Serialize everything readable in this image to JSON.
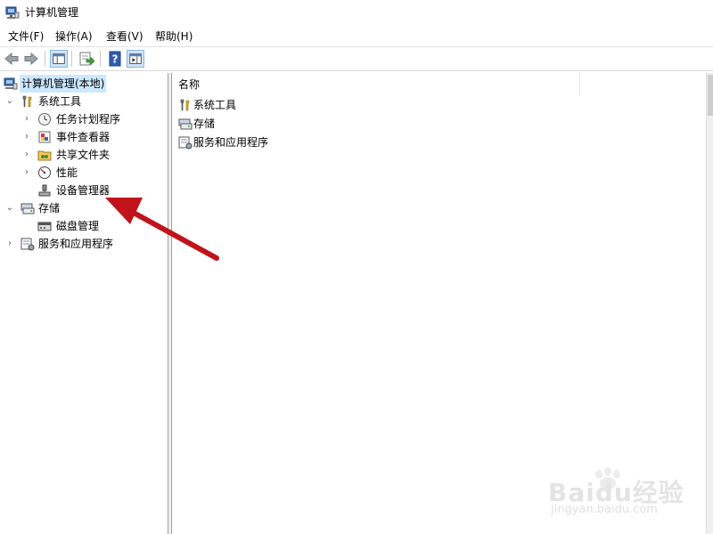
{
  "window": {
    "title": "计算机管理",
    "icon": "computer-management-icon"
  },
  "menu": [
    {
      "label": "文件(F)"
    },
    {
      "label": "操作(A)"
    },
    {
      "label": "查看(V)"
    },
    {
      "label": "帮助(H)"
    }
  ],
  "toolbar": {
    "buttons": [
      "back-arrow-icon",
      "forward-arrow-icon",
      "show-hide-console-tree-icon",
      "export-list-icon",
      "help-icon",
      "show-hide-action-pane-icon"
    ]
  },
  "tree": {
    "root": {
      "label": "计算机管理(本地)",
      "selected": true
    },
    "system_tools": {
      "label": "系统工具",
      "expanded": true
    },
    "task_scheduler": {
      "label": "任务计划程序"
    },
    "event_viewer": {
      "label": "事件查看器"
    },
    "shared_folders": {
      "label": "共享文件夹"
    },
    "performance": {
      "label": "性能"
    },
    "device_manager": {
      "label": "设备管理器"
    },
    "storage": {
      "label": "存储",
      "expanded": true
    },
    "disk_management": {
      "label": "磁盘管理"
    },
    "services_apps": {
      "label": "服务和应用程序"
    }
  },
  "list": {
    "column_name": "名称",
    "items": [
      {
        "label": "系统工具",
        "icon": "tools-icon"
      },
      {
        "label": "存储",
        "icon": "storage-icon"
      },
      {
        "label": "服务和应用程序",
        "icon": "services-icon"
      }
    ]
  },
  "annotation": {
    "color": "#c0131a",
    "points_to": "设备管理器"
  },
  "watermark": {
    "main": "Baidu经验",
    "sub": "jingyan.baidu.com"
  }
}
